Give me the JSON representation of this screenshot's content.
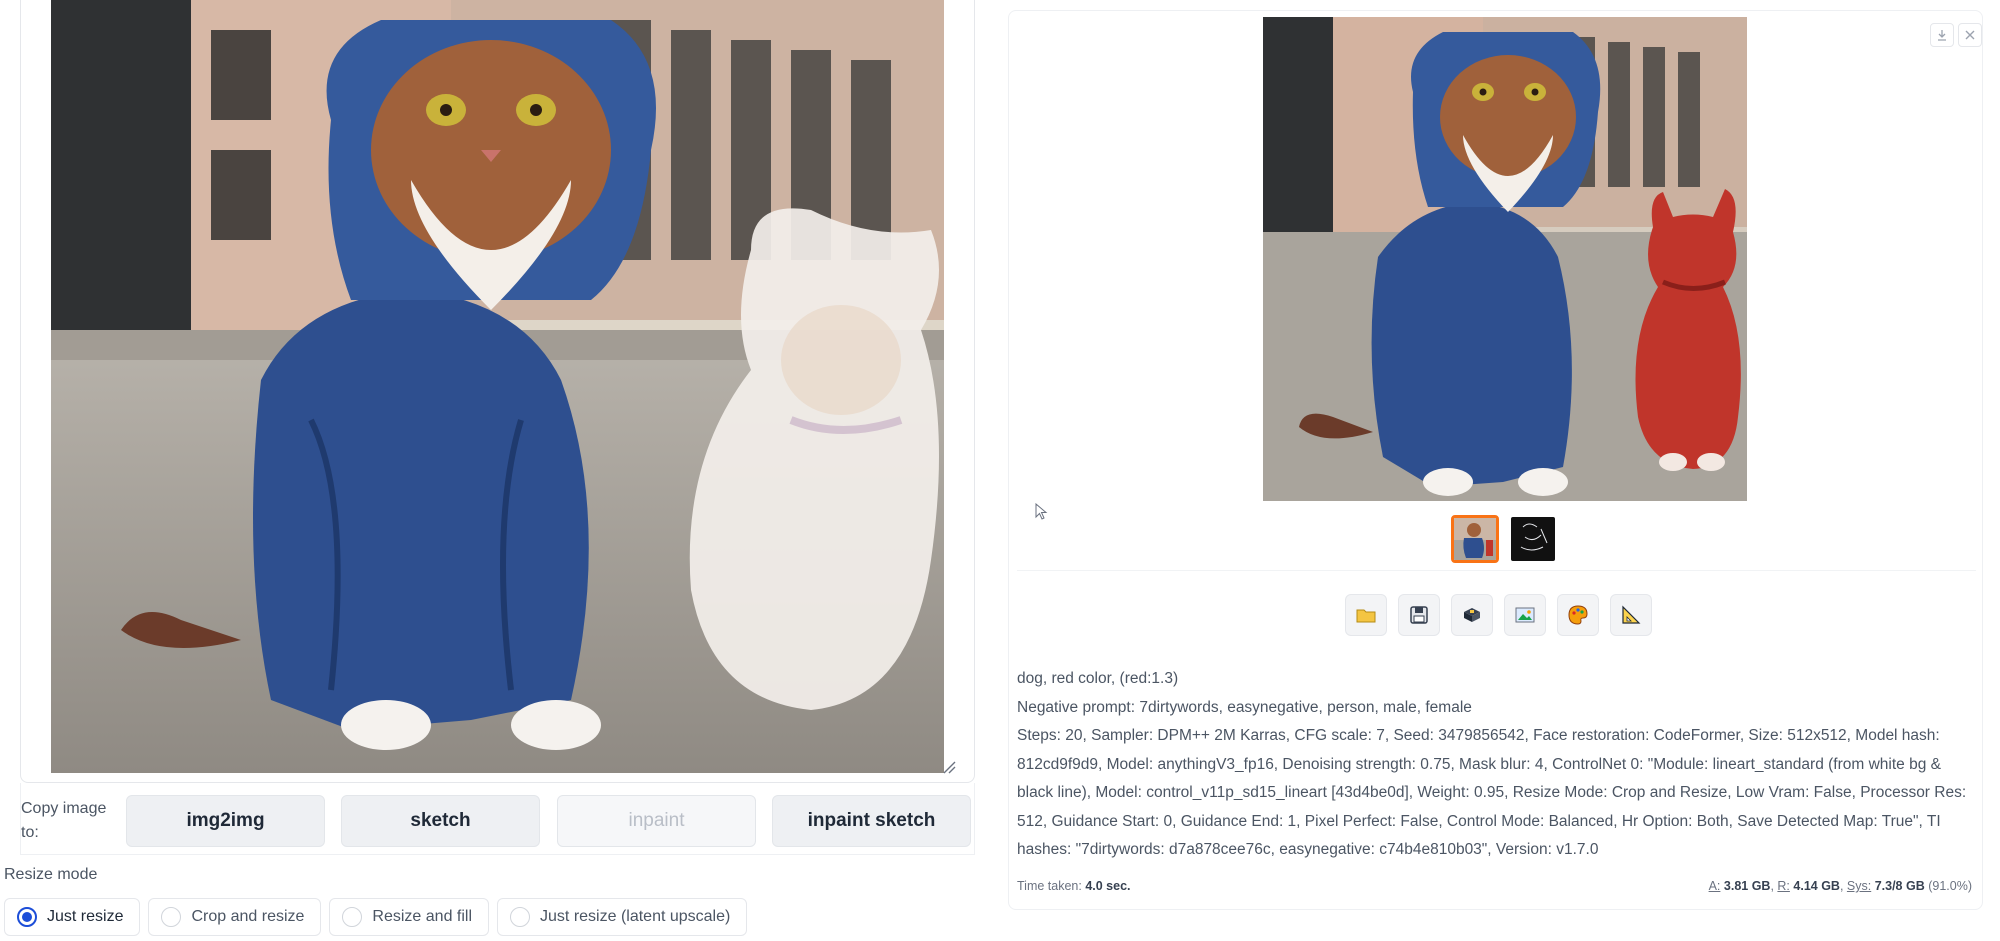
{
  "left": {
    "canvas": {
      "image": "cat-hoodie-with-white-dog-inpaint-canvas"
    },
    "copy_image": {
      "label": "Copy image to:",
      "buttons": [
        {
          "label": "img2img",
          "enabled": true
        },
        {
          "label": "sketch",
          "enabled": true
        },
        {
          "label": "inpaint",
          "enabled": false
        },
        {
          "label": "inpaint sketch",
          "enabled": true
        }
      ]
    },
    "resize_mode": {
      "label": "Resize mode",
      "options": [
        "Just resize",
        "Crop and resize",
        "Resize and fill",
        "Just resize (latent upscale)"
      ],
      "selected": "Just resize"
    }
  },
  "right": {
    "gallery": {
      "main_image": "cat-hoodie-with-red-dog-result",
      "thumbnails": [
        "result-thumbnail",
        "lineart-thumbnail"
      ],
      "active_thumbnail": 0,
      "top_icons": [
        "download-icon",
        "close-icon"
      ]
    },
    "toolbar": [
      "folder-icon",
      "save-icon",
      "zip-icon",
      "image-icon",
      "palette-icon",
      "ruler-icon"
    ],
    "info": {
      "prompt": "dog, red color, (red:1.3)",
      "negative": "Negative prompt: 7dirtywords, easynegative, person, male, female",
      "params": "Steps: 20, Sampler: DPM++ 2M Karras, CFG scale: 7, Seed: 3479856542, Face restoration: CodeFormer, Size: 512x512, Model hash: 812cd9f9d9, Model: anythingV3_fp16, Denoising strength: 0.75, Mask blur: 4, ControlNet 0: \"Module: lineart_standard (from white bg & black line), Model: control_v11p_sd15_lineart [43d4be0d], Weight: 0.95, Resize Mode: Crop and Resize, Low Vram: False, Processor Res: 512, Guidance Start: 0, Guidance End: 1, Pixel Perfect: False, Control Mode: Balanced, Hr Option: Both, Save Detected Map: True\", TI hashes: \"7dirtywords: d7a878cee76c, easynegative: c74b4e810b03\", Version: v1.7.0"
    },
    "footer": {
      "time_label": "Time taken:",
      "time_value": "4.0 sec.",
      "a_label": "A:",
      "a_value": "3.81 GB",
      "r_label": "R:",
      "r_value": "4.14 GB",
      "sys_label": "Sys:",
      "sys_value": "7.3/8 GB",
      "sys_pct": "(91.0%)"
    }
  },
  "colors": {
    "accent": "#f97316",
    "radio": "#1d4ed8",
    "button_bg": "#eef0f3"
  }
}
